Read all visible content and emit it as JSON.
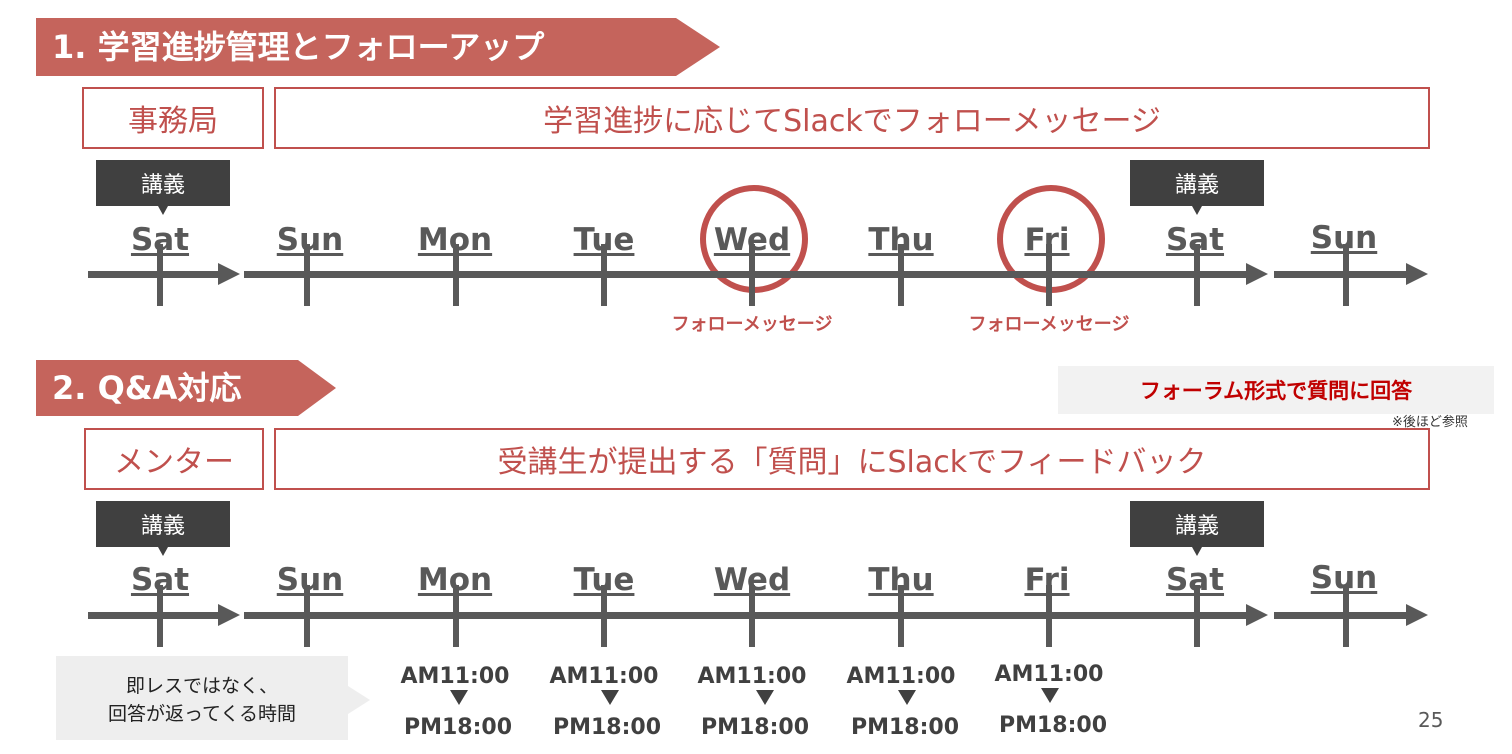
{
  "section1": {
    "header": "1. 学習進捗管理とフォローアップ",
    "role": "事務局",
    "description": "学習進捗に応じてSlackでフォローメッセージ",
    "lecture_label": "講義",
    "days": [
      "Sat",
      "Sun",
      "Mon",
      "Tue",
      "Wed",
      "Thu",
      "Fri",
      "Sat",
      "Sun"
    ],
    "highlighted_days": [
      "Wed",
      "Fri"
    ],
    "follow_label": "フォローメッセージ",
    "colors": {
      "accent": "#c0504d",
      "timeline": "#595959",
      "banner": "#c5645c"
    }
  },
  "section2": {
    "header": "2. Q&A対応",
    "role": "メンター",
    "description": "受講生が提出する「質問」にSlackでフィードバック",
    "lecture_label": "講義",
    "days": [
      "Sat",
      "Sun",
      "Mon",
      "Tue",
      "Wed",
      "Thu",
      "Fri",
      "Sat",
      "Sun"
    ],
    "callout": "フォーラム形式で質問に回答",
    "callout_note": "※後ほど参照",
    "response_note": "即レスではなく、\n回答が返ってくる時間",
    "response_times": [
      {
        "day": "Mon",
        "start": "AM11:00",
        "end": "PM18:00"
      },
      {
        "day": "Tue",
        "start": "AM11:00",
        "end": "PM18:00"
      },
      {
        "day": "Wed",
        "start": "AM11:00",
        "end": "PM18:00"
      },
      {
        "day": "Thu",
        "start": "AM11:00",
        "end": "PM18:00"
      },
      {
        "day": "Fri",
        "start": "AM11:00",
        "end": "PM18:00"
      }
    ]
  },
  "page_number": "25"
}
